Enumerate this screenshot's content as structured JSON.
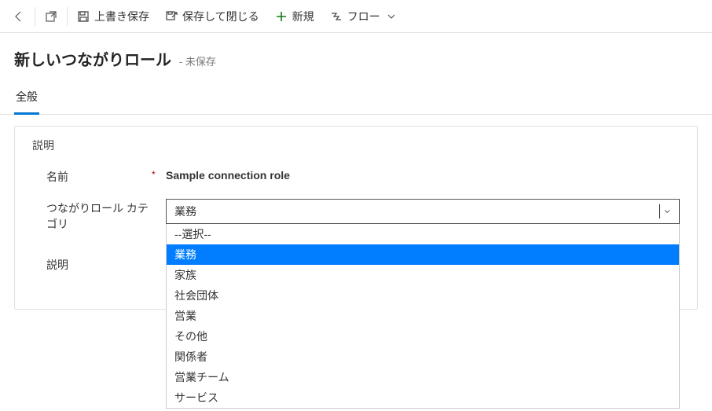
{
  "cmdbar": {
    "back": "戻る",
    "popout": "外部で開く",
    "save": "上書き保存",
    "save_close": "保存して閉じる",
    "new": "新規",
    "flow": "フロー"
  },
  "header": {
    "title": "新しいつながりロール",
    "suffix": "- 未保存"
  },
  "tabs": {
    "general": "全般"
  },
  "section": {
    "title": "説明",
    "name_label": "名前",
    "name_value": "Sample connection role",
    "category_label": "つながりロール カテゴリ",
    "desc_label": "説明"
  },
  "select": {
    "value": "業務",
    "options": [
      {
        "label": "--選択--",
        "selected": false
      },
      {
        "label": "業務",
        "selected": true
      },
      {
        "label": "家族",
        "selected": false
      },
      {
        "label": "社会団体",
        "selected": false
      },
      {
        "label": "営業",
        "selected": false
      },
      {
        "label": "その他",
        "selected": false
      },
      {
        "label": "関係者",
        "selected": false
      },
      {
        "label": "営業チーム",
        "selected": false
      },
      {
        "label": "サービス",
        "selected": false
      }
    ]
  }
}
